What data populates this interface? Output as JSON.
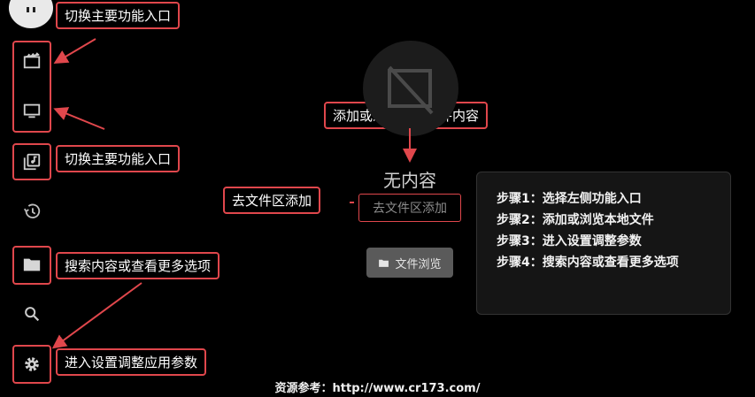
{
  "sidebar": {
    "items": [
      {
        "icon": "movie-icon",
        "name": "sidebar-item-movies"
      },
      {
        "icon": "tv-icon",
        "name": "sidebar-item-tv"
      },
      {
        "icon": "music-library-icon",
        "name": "sidebar-item-music"
      },
      {
        "icon": "history-icon",
        "name": "sidebar-item-history"
      },
      {
        "icon": "folder-icon",
        "name": "sidebar-item-files"
      },
      {
        "icon": "search-icon",
        "name": "sidebar-item-search"
      },
      {
        "icon": "gear-icon",
        "name": "sidebar-item-settings"
      }
    ]
  },
  "annotations": {
    "switch_main_1": "切换主要功能入口",
    "switch_main_2": "切换主要功能入口",
    "search_more": "搜索内容或查看更多选项",
    "settings_params": "进入设置调整应用参数",
    "add_browse_local": "添加或浏览本地文件内容",
    "go_files_add": "去文件区添加"
  },
  "main": {
    "empty_title": "无内容",
    "add_link": "去文件区添加",
    "browse_button": "文件浏览"
  },
  "tips": {
    "steps": [
      "步骤1：选择左侧功能入口",
      "步骤2：添加或浏览本地文件",
      "步骤3：进入设置调整参数",
      "步骤4：搜索内容或查看更多选项"
    ]
  },
  "footer": {
    "source": "资源参考：http://www.cr173.com/"
  },
  "colors": {
    "annotation_red": "#e0474c",
    "background": "#000000",
    "panel": "#151515"
  }
}
